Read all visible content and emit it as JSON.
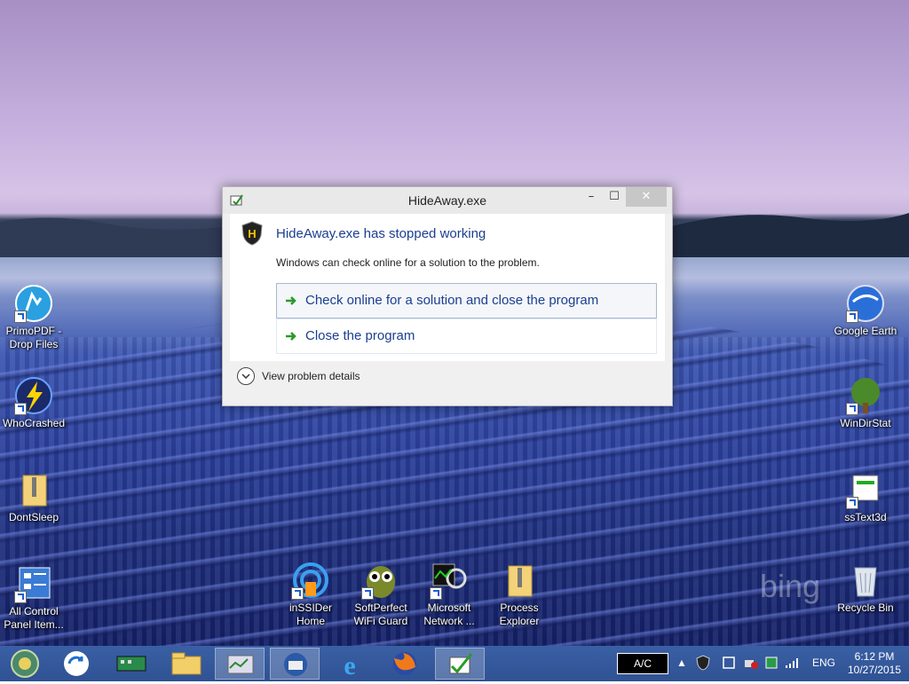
{
  "dialog": {
    "title": "HideAway.exe",
    "heading": "HideAway.exe has stopped working",
    "message": "Windows can check online for a solution to the problem.",
    "option_check_online": "Check online for a solution and close the program",
    "option_close": "Close the program",
    "details_label": "View problem details",
    "minimize_glyph": "–",
    "maximize_glyph": "☐",
    "close_glyph": "✕"
  },
  "desktop_icons_left": [
    {
      "label": "PrimoPDF - Drop Files"
    },
    {
      "label": "WhoCrashed"
    },
    {
      "label": "DontSleep"
    },
    {
      "label": "All Control Panel Item..."
    }
  ],
  "desktop_icons_right": [
    {
      "label": "Google Earth"
    },
    {
      "label": "WinDirStat"
    },
    {
      "label": "ssText3d"
    },
    {
      "label": "Recycle Bin"
    }
  ],
  "desktop_icons_bottom": [
    {
      "label": "inSSIDer Home"
    },
    {
      "label": "SoftPerfect WiFi Guard"
    },
    {
      "label": "Microsoft Network ..."
    },
    {
      "label": "Process Explorer"
    }
  ],
  "wallpaper_watermark": "bing",
  "taskbar": {
    "ac_label": "A/C",
    "language": "ENG",
    "time": "6:12 PM",
    "date": "10/27/2015"
  },
  "colors": {
    "taskbar": "#2f5293",
    "link_blue": "#1b3f8f",
    "close_button": "#c7c7c7"
  }
}
